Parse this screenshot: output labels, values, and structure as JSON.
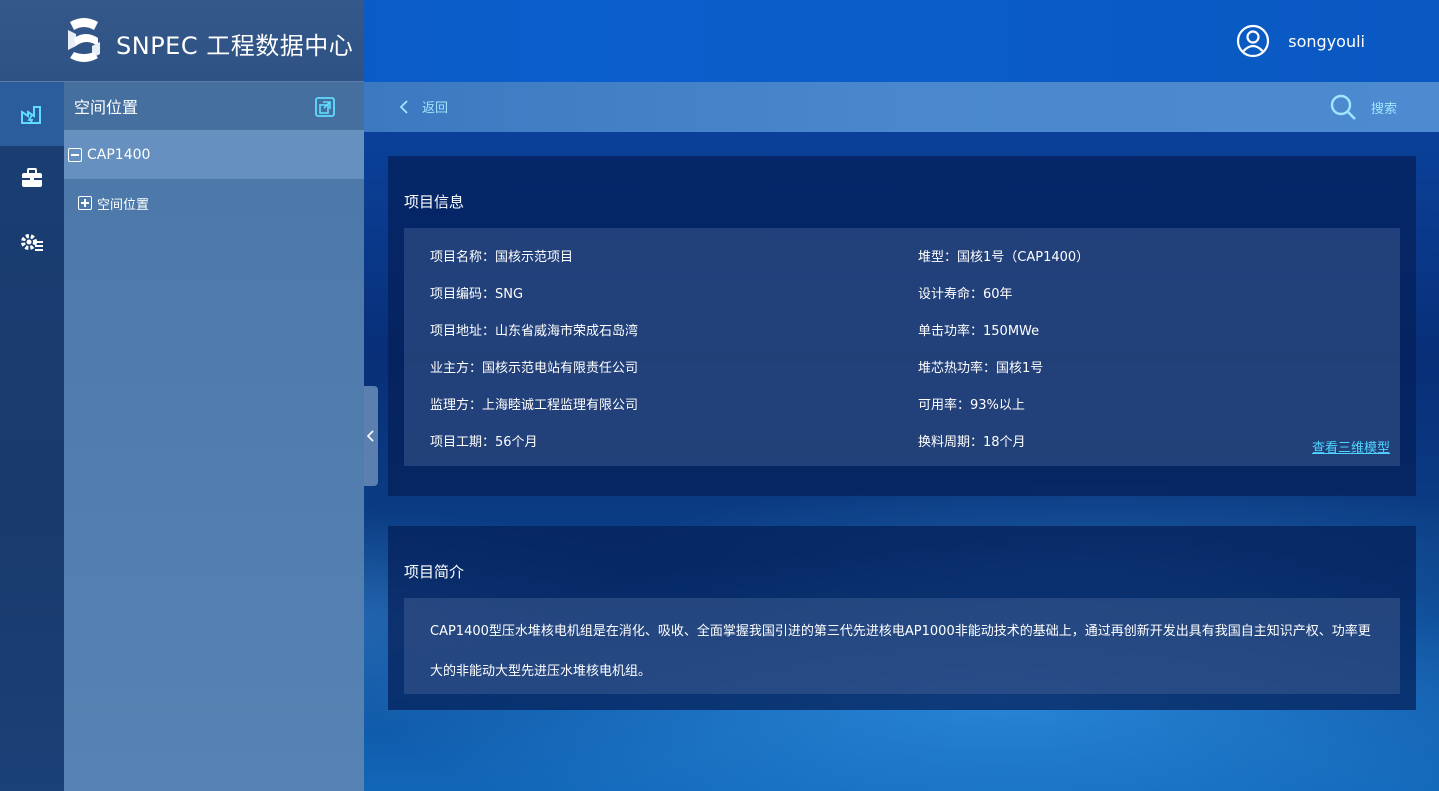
{
  "header": {
    "logo_icon": "snpec-logo-icon",
    "app_title": "SNPEC 工程数据中心",
    "user_icon": "user-circle-icon",
    "username": "songyouli"
  },
  "rail": {
    "items": [
      {
        "icon": "factory-icon",
        "active": true
      },
      {
        "icon": "briefcase-icon",
        "active": false
      },
      {
        "icon": "gear-list-icon",
        "active": false
      }
    ]
  },
  "tree": {
    "title": "空间位置",
    "header_icon": "export-icon",
    "root_label": "CAP1400",
    "child_label": "空间位置"
  },
  "toolbar": {
    "back_label": "返回",
    "search_label": "搜索"
  },
  "project_info": {
    "title": "项目信息",
    "left": [
      "项目名称：国核示范项目",
      "项目编码：SNG",
      "项目地址：山东省威海市荣成石岛湾",
      "业主方：国核示范电站有限责任公司",
      "监理方：上海睦诚工程监理有限公司",
      "项目工期：56个月"
    ],
    "right": [
      "堆型：国核1号（CAP1400）",
      "设计寿命：60年",
      "单击功率：150MWe",
      "堆芯热功率：国核1号",
      "可用率：93%以上",
      "换料周期：18个月"
    ],
    "view_model_link": "查看三维模型"
  },
  "project_intro": {
    "title": "项目简介",
    "text": "CAP1400型压水堆核电机组是在消化、吸收、全面掌握我国引进的第三代先进核电AP1000非能动技术的基础上，通过再创新开发出具有我国自主知识产权、功率更大的非能动大型先进压水堆核电机组。"
  },
  "colors": {
    "accent": "#4fd3ff",
    "toolbar_text": "#9fe6ff"
  }
}
